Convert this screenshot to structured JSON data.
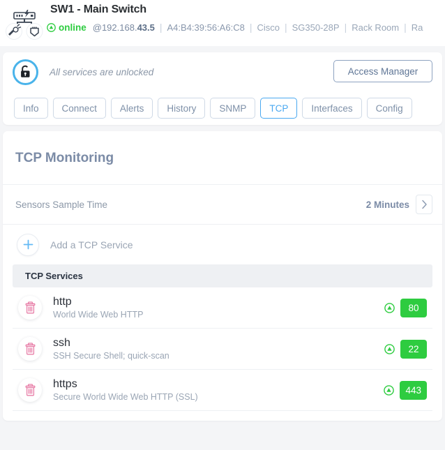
{
  "device": {
    "icon": "network-switch-icon",
    "title": "SW1 - Main Switch",
    "status_icon": "status-online-icon",
    "status": "online",
    "ip_prefix": "@192.168.",
    "ip_suffix": "43.5",
    "mac": "A4:B4:39:56:A6:C8",
    "vendor": "Cisco",
    "model": "SG350-28P",
    "location": "Rack Room",
    "location_extra": "Ra",
    "separator": "|"
  },
  "lockbar": {
    "lock_icon": "unlock-icon",
    "message": "All services are unlocked",
    "access_button": "Access Manager"
  },
  "tabs": [
    {
      "label": "Info",
      "active": false
    },
    {
      "label": "Connect",
      "active": false
    },
    {
      "label": "Alerts",
      "active": false
    },
    {
      "label": "History",
      "active": false
    },
    {
      "label": "SNMP",
      "active": false
    },
    {
      "label": "TCP",
      "active": true
    },
    {
      "label": "Interfaces",
      "active": false
    },
    {
      "label": "Config",
      "active": false
    }
  ],
  "monitoring": {
    "title": "TCP Monitoring",
    "sample_time_label": "Sensors Sample Time",
    "sample_time_value": "2 Minutes",
    "chevron_icon": "chevron-right-icon",
    "add_icon": "plus-icon",
    "add_label": "Add a TCP Service",
    "services_header": "TCP Services",
    "services": [
      {
        "delete_icon": "trash-icon",
        "name": "http",
        "description": "World Wide Web HTTP",
        "status_icon": "status-up-icon",
        "port": "80"
      },
      {
        "delete_icon": "trash-icon",
        "name": "ssh",
        "description": "SSH Secure Shell; quick-scan",
        "status_icon": "status-up-icon",
        "port": "22"
      },
      {
        "delete_icon": "trash-icon",
        "name": "https",
        "description": "Secure World Wide Web HTTP (SSL)",
        "status_icon": "status-up-icon",
        "port": "443"
      }
    ]
  },
  "colors": {
    "accent_blue": "#4aa8f0",
    "status_green": "#2ecc40",
    "slate": "#7b8ba6",
    "muted": "#9aa5b4",
    "delete_pink": "#e87fa8"
  }
}
